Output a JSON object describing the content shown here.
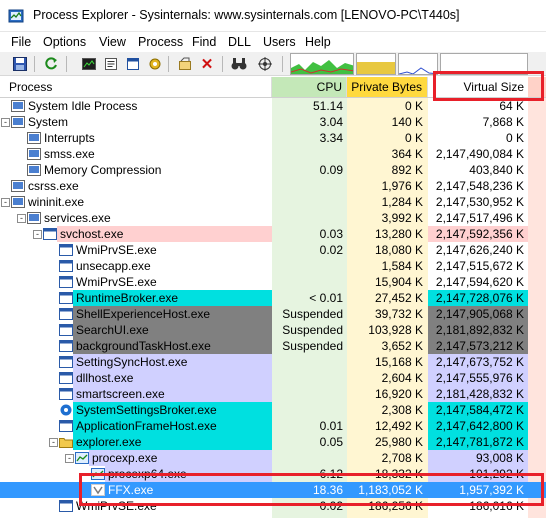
{
  "window": {
    "title": "Process Explorer - Sysinternals: www.sysinternals.com [LENOVO-PC\\T440s]"
  },
  "menu": [
    "File",
    "Options",
    "View",
    "Process",
    "Find",
    "DLL",
    "Users",
    "Help"
  ],
  "toolbar": {
    "icons": [
      "save-icon",
      "refresh-icon",
      "system-info-icon",
      "properties-icon",
      "window-icon",
      "gear-icon",
      "handle-icon",
      "kill-icon",
      "find-icon",
      "target-icon"
    ]
  },
  "columns": {
    "process": "Process",
    "cpu": "CPU",
    "private_bytes": "Private Bytes",
    "virtual_size": "Virtual Size"
  },
  "colors": {
    "cpu_column": "#c4e8b8",
    "private_bytes_column": "#ffd93f",
    "service_highlight": "#ffd0d0",
    "own_process_highlight": "#d0d0ff",
    "immersive_highlight": "#00e0e0",
    "suspended_highlight": "#808080",
    "selected_row": "#3399ff",
    "annotation": "#e8202a"
  },
  "processes": [
    {
      "name": "System Idle Process",
      "depth": 0,
      "twisty": "",
      "cpu": "51.14",
      "private": "0 K",
      "virtual": "64 K",
      "highlight": "",
      "icon": "system"
    },
    {
      "name": "System",
      "depth": 0,
      "twisty": "-",
      "cpu": "3.04",
      "private": "140 K",
      "virtual": "7,868 K",
      "highlight": "",
      "icon": "system"
    },
    {
      "name": "Interrupts",
      "depth": 1,
      "twisty": "",
      "cpu": "3.34",
      "private": "0 K",
      "virtual": "0 K",
      "highlight": "",
      "icon": "system"
    },
    {
      "name": "smss.exe",
      "depth": 1,
      "twisty": "",
      "cpu": "",
      "private": "364 K",
      "virtual": "2,147,490,084 K",
      "highlight": "",
      "icon": "system"
    },
    {
      "name": "Memory Compression",
      "depth": 1,
      "twisty": "",
      "cpu": "0.09",
      "private": "892 K",
      "virtual": "403,840 K",
      "highlight": "",
      "icon": "system"
    },
    {
      "name": "csrss.exe",
      "depth": 0,
      "twisty": "",
      "cpu": "",
      "private": "1,976 K",
      "virtual": "2,147,548,236 K",
      "highlight": "",
      "icon": "system"
    },
    {
      "name": "wininit.exe",
      "depth": 0,
      "twisty": "-",
      "cpu": "",
      "private": "1,284 K",
      "virtual": "2,147,530,952 K",
      "highlight": "",
      "icon": "system"
    },
    {
      "name": "services.exe",
      "depth": 1,
      "twisty": "-",
      "cpu": "",
      "private": "3,992 K",
      "virtual": "2,147,517,496 K",
      "highlight": "",
      "icon": "system"
    },
    {
      "name": "svchost.exe",
      "depth": 2,
      "twisty": "-",
      "cpu": "0.03",
      "private": "13,280 K",
      "virtual": "2,147,592,356 K",
      "highlight": "service",
      "icon": "window"
    },
    {
      "name": "WmiPrvSE.exe",
      "depth": 3,
      "twisty": "",
      "cpu": "0.02",
      "private": "18,080 K",
      "virtual": "2,147,626,240 K",
      "highlight": "",
      "icon": "window"
    },
    {
      "name": "unsecapp.exe",
      "depth": 3,
      "twisty": "",
      "cpu": "",
      "private": "1,584 K",
      "virtual": "2,147,515,672 K",
      "highlight": "",
      "icon": "window"
    },
    {
      "name": "WmiPrvSE.exe",
      "depth": 3,
      "twisty": "",
      "cpu": "",
      "private": "15,904 K",
      "virtual": "2,147,594,620 K",
      "highlight": "",
      "icon": "window"
    },
    {
      "name": "RuntimeBroker.exe",
      "depth": 3,
      "twisty": "",
      "cpu": "< 0.01",
      "private": "27,452 K",
      "virtual": "2,147,728,076 K",
      "highlight": "immersive",
      "icon": "window"
    },
    {
      "name": "ShellExperienceHost.exe",
      "depth": 3,
      "twisty": "",
      "cpu": "Suspended",
      "private": "39,732 K",
      "virtual": "2,147,905,068 K",
      "highlight": "suspended",
      "icon": "window"
    },
    {
      "name": "SearchUI.exe",
      "depth": 3,
      "twisty": "",
      "cpu": "Suspended",
      "private": "103,928 K",
      "virtual": "2,181,892,832 K",
      "highlight": "suspended",
      "icon": "window"
    },
    {
      "name": "backgroundTaskHost.exe",
      "depth": 3,
      "twisty": "",
      "cpu": "Suspended",
      "private": "3,652 K",
      "virtual": "2,147,573,212 K",
      "highlight": "suspended",
      "icon": "window"
    },
    {
      "name": "SettingSyncHost.exe",
      "depth": 3,
      "twisty": "",
      "cpu": "",
      "private": "15,168 K",
      "virtual": "2,147,673,752 K",
      "highlight": "own",
      "icon": "window"
    },
    {
      "name": "dllhost.exe",
      "depth": 3,
      "twisty": "",
      "cpu": "",
      "private": "2,604 K",
      "virtual": "2,147,555,976 K",
      "highlight": "own",
      "icon": "window"
    },
    {
      "name": "smartscreen.exe",
      "depth": 3,
      "twisty": "",
      "cpu": "",
      "private": "16,920 K",
      "virtual": "2,181,428,832 K",
      "highlight": "own",
      "icon": "window"
    },
    {
      "name": "SystemSettingsBroker.exe",
      "depth": 3,
      "twisty": "",
      "cpu": "",
      "private": "2,308 K",
      "virtual": "2,147,584,472 K",
      "highlight": "immersive",
      "icon": "gear"
    },
    {
      "name": "ApplicationFrameHost.exe",
      "depth": 3,
      "twisty": "",
      "cpu": "0.01",
      "private": "12,492 K",
      "virtual": "2,147,642,800 K",
      "highlight": "immersive",
      "icon": "window"
    },
    {
      "name": "explorer.exe",
      "depth": 3,
      "twisty": "-",
      "cpu": "0.05",
      "private": "25,980 K",
      "virtual": "2,147,781,872 K",
      "highlight": "immersive",
      "icon": "folder"
    },
    {
      "name": "procexp.exe",
      "depth": 4,
      "twisty": "-",
      "cpu": "",
      "private": "2,708 K",
      "virtual": "93,008 K",
      "highlight": "own",
      "icon": "procexp"
    },
    {
      "name": "procexp64.exe",
      "depth": 5,
      "twisty": "",
      "cpu": "6.12",
      "private": "18,332 K",
      "virtual": "101,292 K",
      "highlight": "own",
      "icon": "procexp"
    },
    {
      "name": "FFX.exe",
      "depth": 5,
      "twisty": "",
      "cpu": "18.36",
      "private": "1,183,052 K",
      "virtual": "1,957,392 K",
      "highlight": "selected",
      "icon": "ffx"
    },
    {
      "name": "WmiPrvSE.exe",
      "depth": 3,
      "twisty": "",
      "cpu": "0.02",
      "private": "186,256 K",
      "virtual": "186,016 K",
      "highlight": "",
      "icon": "window"
    }
  ]
}
